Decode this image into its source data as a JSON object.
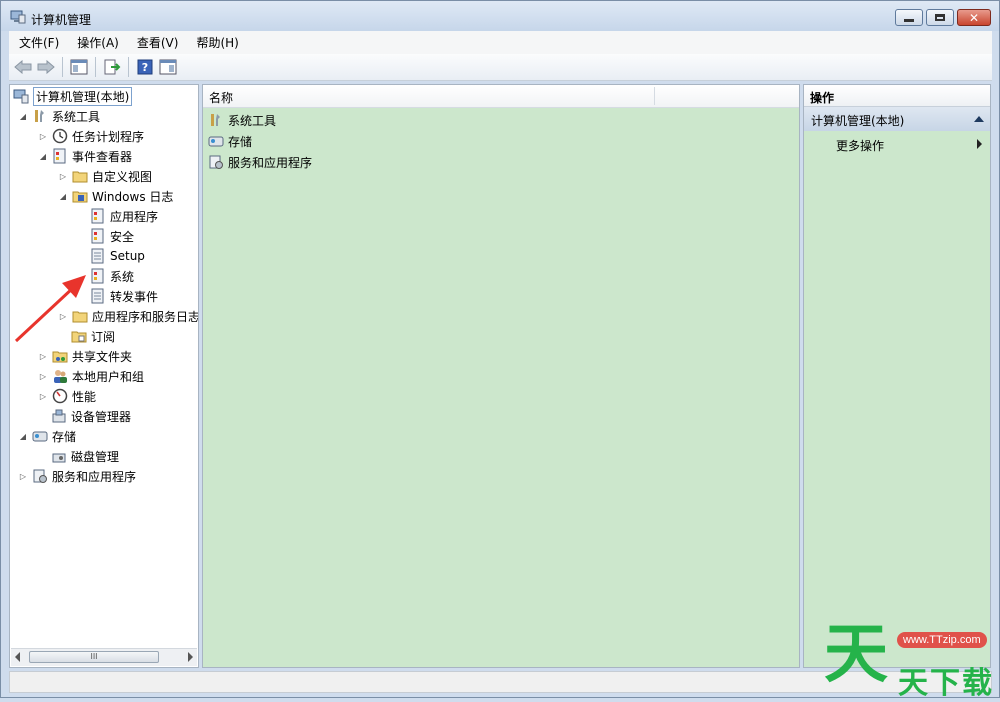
{
  "window": {
    "title": "计算机管理"
  },
  "menu": [
    "文件(F)",
    "操作(A)",
    "查看(V)",
    "帮助(H)"
  ],
  "tree": {
    "root": "计算机管理(本地)",
    "system_tools": "系统工具",
    "task_scheduler": "任务计划程序",
    "event_viewer": "事件查看器",
    "custom_views": "自定义视图",
    "windows_logs": "Windows 日志",
    "application": "应用程序",
    "security": "安全",
    "setup": "Setup",
    "system": "系统",
    "forwarded_events": "转发事件",
    "app_service_logs": "应用程序和服务日志",
    "subscriptions": "订阅",
    "shared_folders": "共享文件夹",
    "local_users_groups": "本地用户和组",
    "performance": "性能",
    "device_manager": "设备管理器",
    "storage": "存储",
    "disk_management": "磁盘管理",
    "services_apps": "服务和应用程序"
  },
  "list": {
    "column_name": "名称",
    "items": [
      "系统工具",
      "存储",
      "服务和应用程序"
    ]
  },
  "actions": {
    "header": "操作",
    "section": "计算机管理(本地)",
    "more": "更多操作"
  },
  "scrollbar": {
    "thumb_label": "III"
  },
  "watermark": {
    "url": "www.TTzip.com",
    "big": "天",
    "small": "天下载"
  },
  "colors": {
    "content_bg": "#cce7cc",
    "annotation_arrow": "#e8342c"
  }
}
